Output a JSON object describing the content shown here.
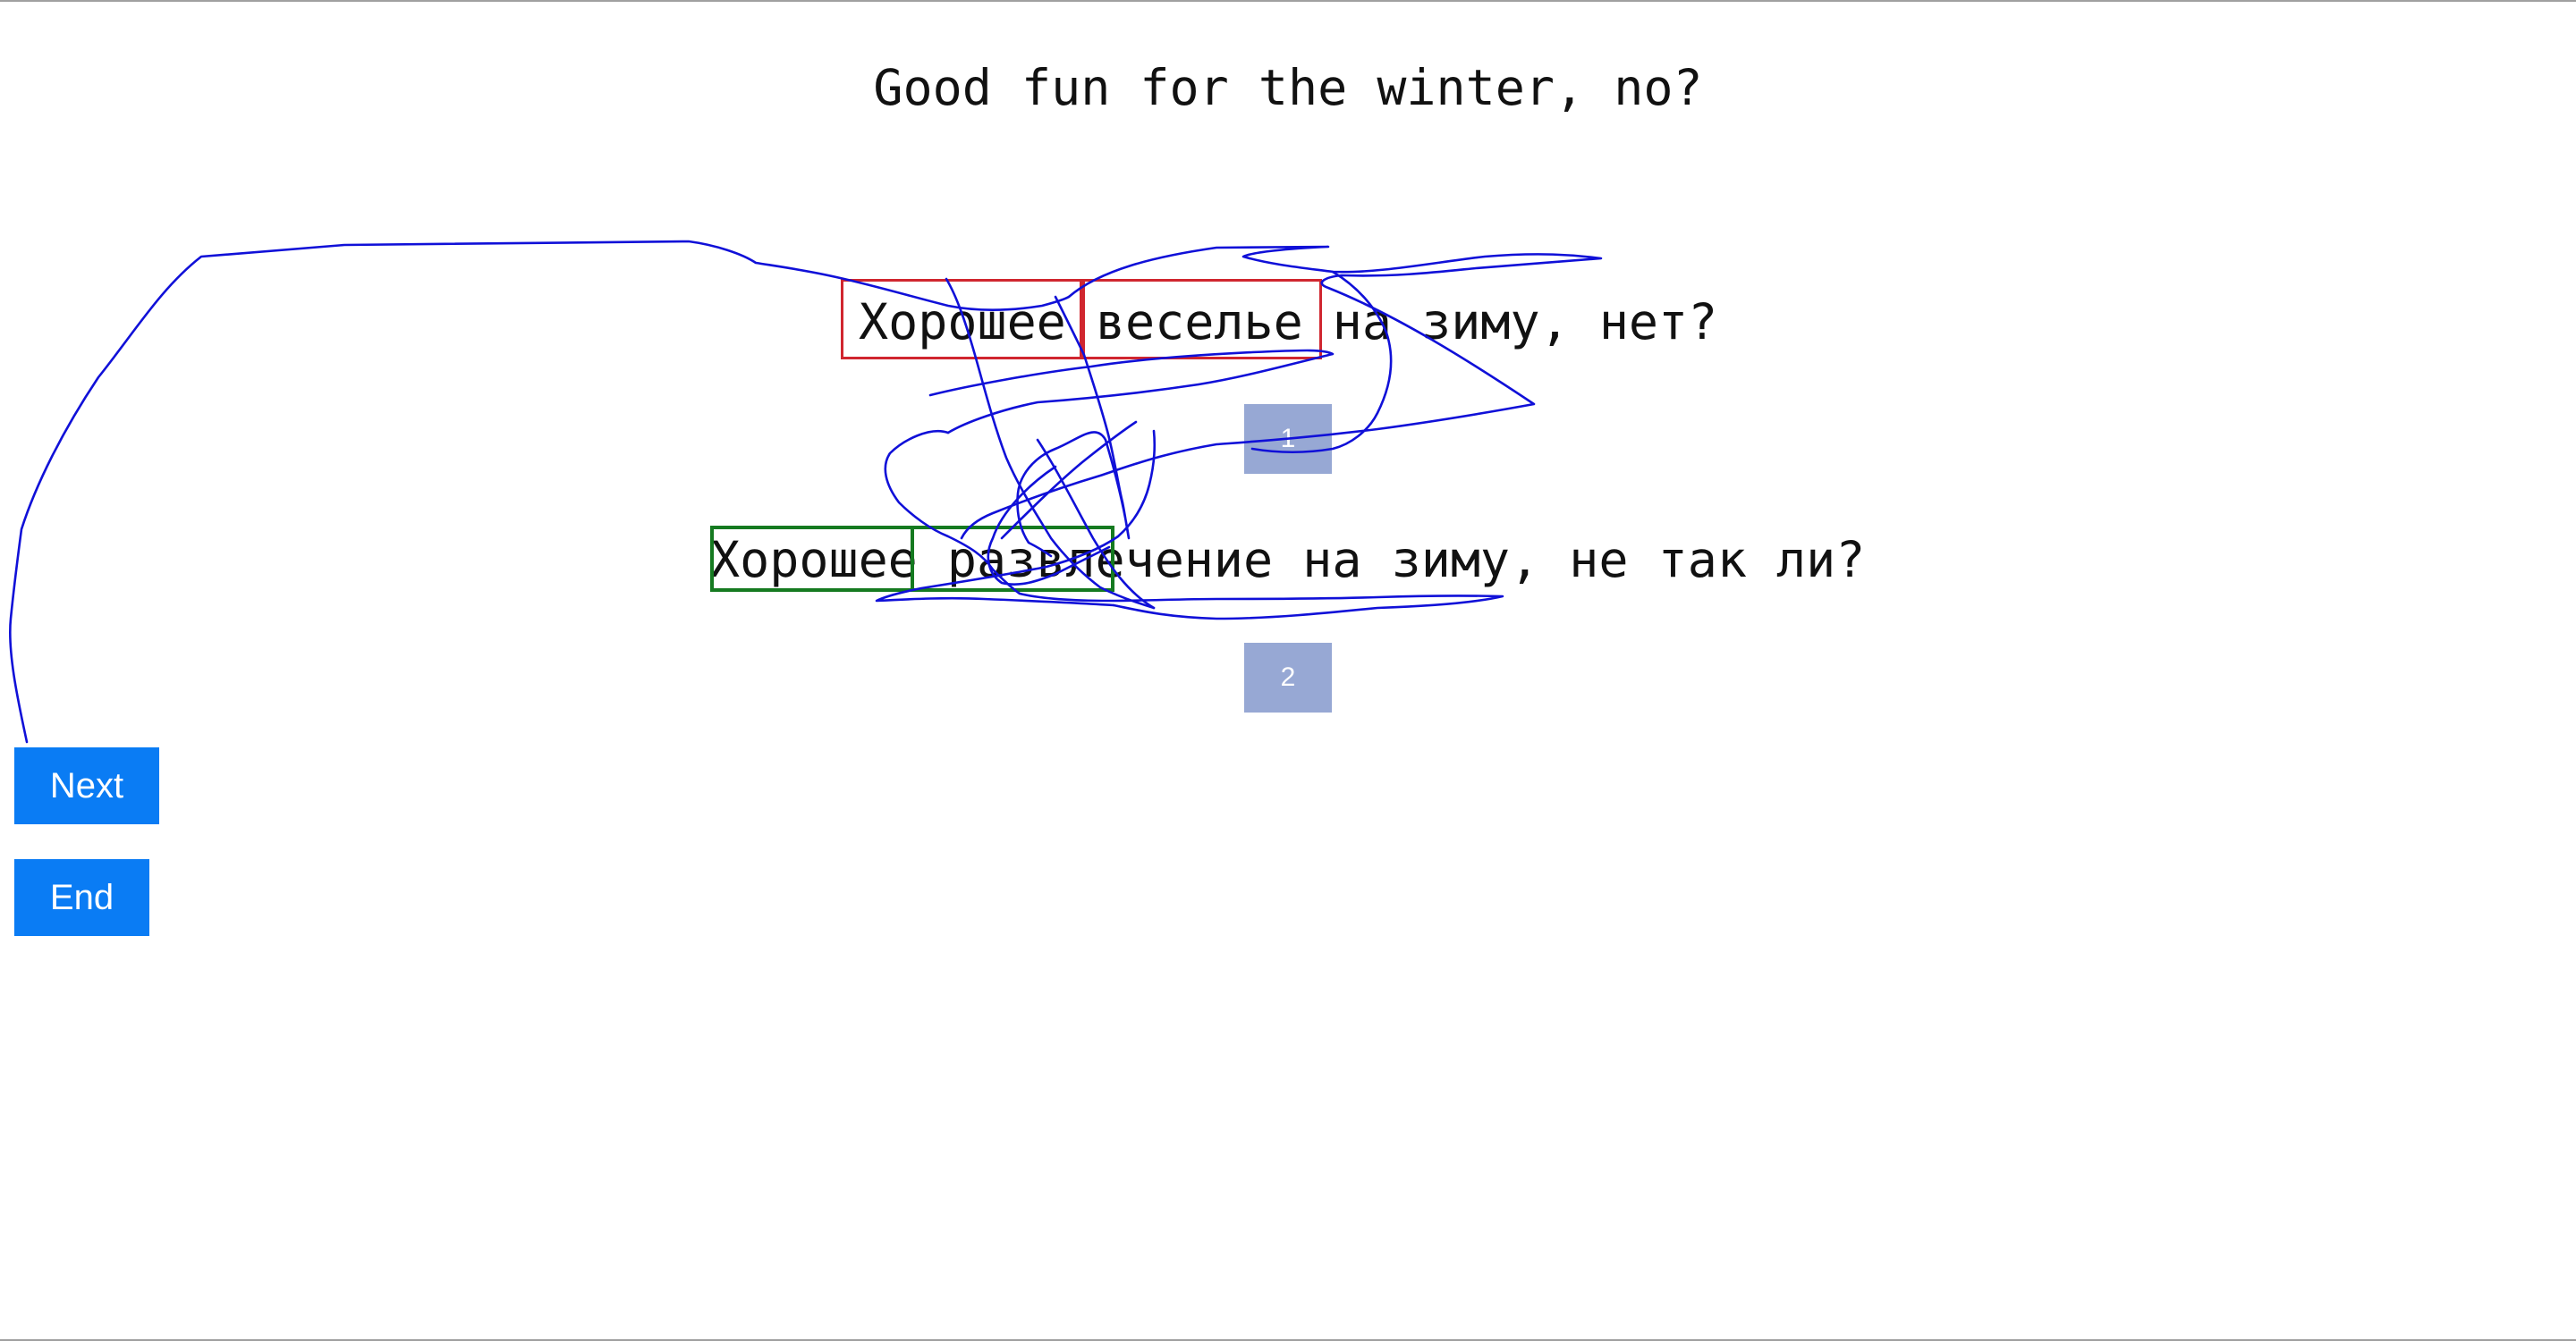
{
  "source_sentence": "Good fun for the winter, no?",
  "candidates": [
    {
      "text": "Хорошее веселье на зиму, нет?",
      "rank_label": "1",
      "highlight_color": "#d0262f"
    },
    {
      "text": "Хорошее развлечение на зиму, не так ли?",
      "rank_label": "2",
      "highlight_color": "#157a20"
    }
  ],
  "buttons": {
    "next_label": "Next",
    "end_label": "End"
  },
  "colors": {
    "button_bg": "#0a7cf4",
    "rank_bg": "#97a8d4",
    "ink": "#1010d8"
  }
}
